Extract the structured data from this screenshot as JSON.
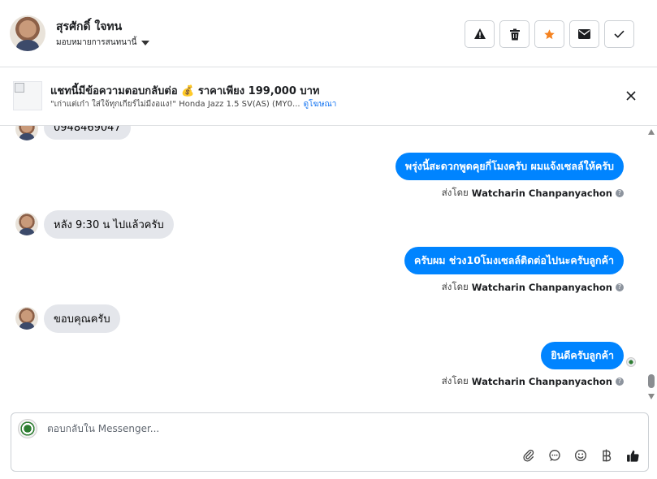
{
  "header": {
    "contact_name": "สุรศักดิ์ ใจทน",
    "assign_label": "มอบหมายการสนทนานี้",
    "actions": [
      "warning-icon",
      "trash-icon",
      "star-icon",
      "envelope-icon",
      "check-icon"
    ],
    "star_color": "#f5821f"
  },
  "ad": {
    "title": "แชทนี้มีข้อความตอบกลับต่อ 💰 ราคาเพียง 199,000 บาท",
    "subtitle": "\"เก่าแต่เก๋า ใส่ใจ้ทุกเกียร์ไม่มีงอแง!\"  Honda Jazz 1.5 SV(AS) (MY0...",
    "link": "ดูโฆษณา"
  },
  "messages": [
    {
      "dir": "in",
      "text": "0948469047"
    },
    {
      "dir": "out",
      "text": "พรุ่งนี้สะดวกพูดคุยกี่โมงครับ ผมแจ้งเซลล์ให้ครับ"
    },
    {
      "dir": "in",
      "text": "หลัง 9:30 น ไปแล้วครับ"
    },
    {
      "dir": "out",
      "text": "ครับผม ช่วง10โมงเซลล์ติดต่อไปนะครับลูกค้า"
    },
    {
      "dir": "in",
      "text": "ขอบคุณครับ"
    },
    {
      "dir": "out",
      "text": "ยินดีครับลูกค้า"
    }
  ],
  "sent_by_prefix": "ส่งโดย",
  "sent_by_name": "Watcharin Chanpanyachon",
  "composer": {
    "placeholder": "ตอบกลับใน Messenger...",
    "tools": [
      "paperclip-icon",
      "saved-reply-icon",
      "emoji-icon",
      "baht-icon",
      "thumbs-up-icon"
    ]
  },
  "colors": {
    "outgoing_bubble": "#0084ff",
    "incoming_bubble": "#e4e6eb"
  }
}
